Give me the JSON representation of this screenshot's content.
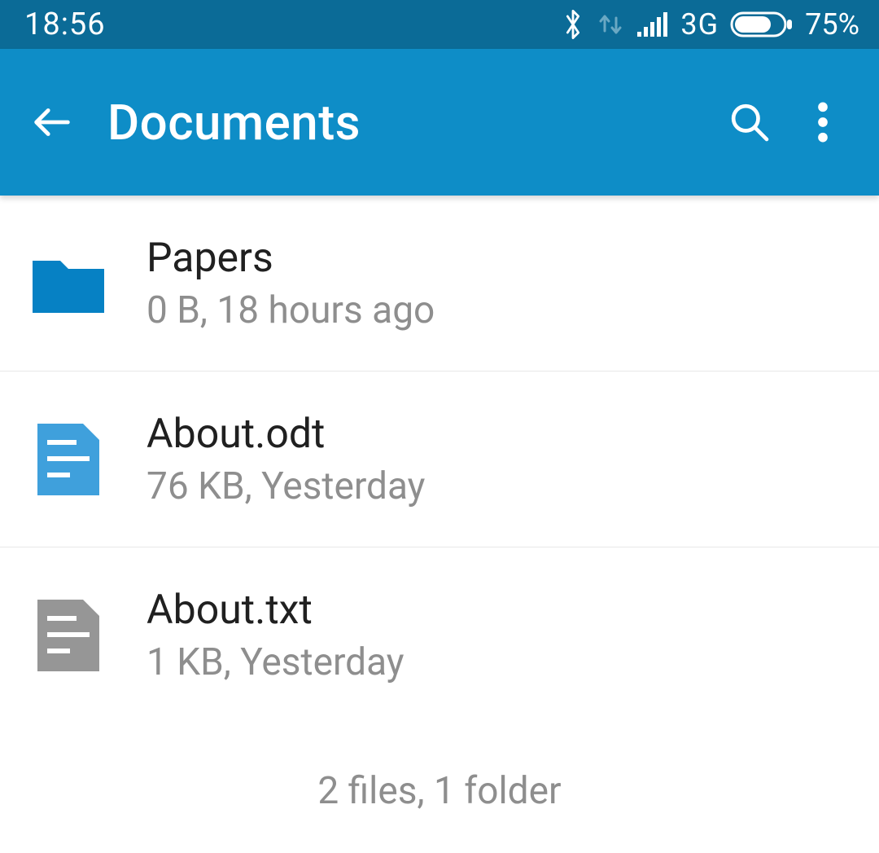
{
  "status_bar": {
    "time": "18:56",
    "network_type": "3G",
    "battery_percent": "75%"
  },
  "app_bar": {
    "title": "Documents"
  },
  "items": [
    {
      "name": "Papers",
      "meta": "0 B, 18 hours ago",
      "icon": "folder"
    },
    {
      "name": "About.odt",
      "meta": "76 KB, Yesterday",
      "icon": "doc-blue"
    },
    {
      "name": "About.txt",
      "meta": "1 KB, Yesterday",
      "icon": "doc-grey"
    }
  ],
  "summary": "2 files, 1 folder",
  "colors": {
    "status_bar_bg": "#0b6b97",
    "app_bar_bg": "#0e8dc7",
    "folder": "#0681c4",
    "doc_blue": "#3fa0dc",
    "doc_grey": "#969696"
  }
}
